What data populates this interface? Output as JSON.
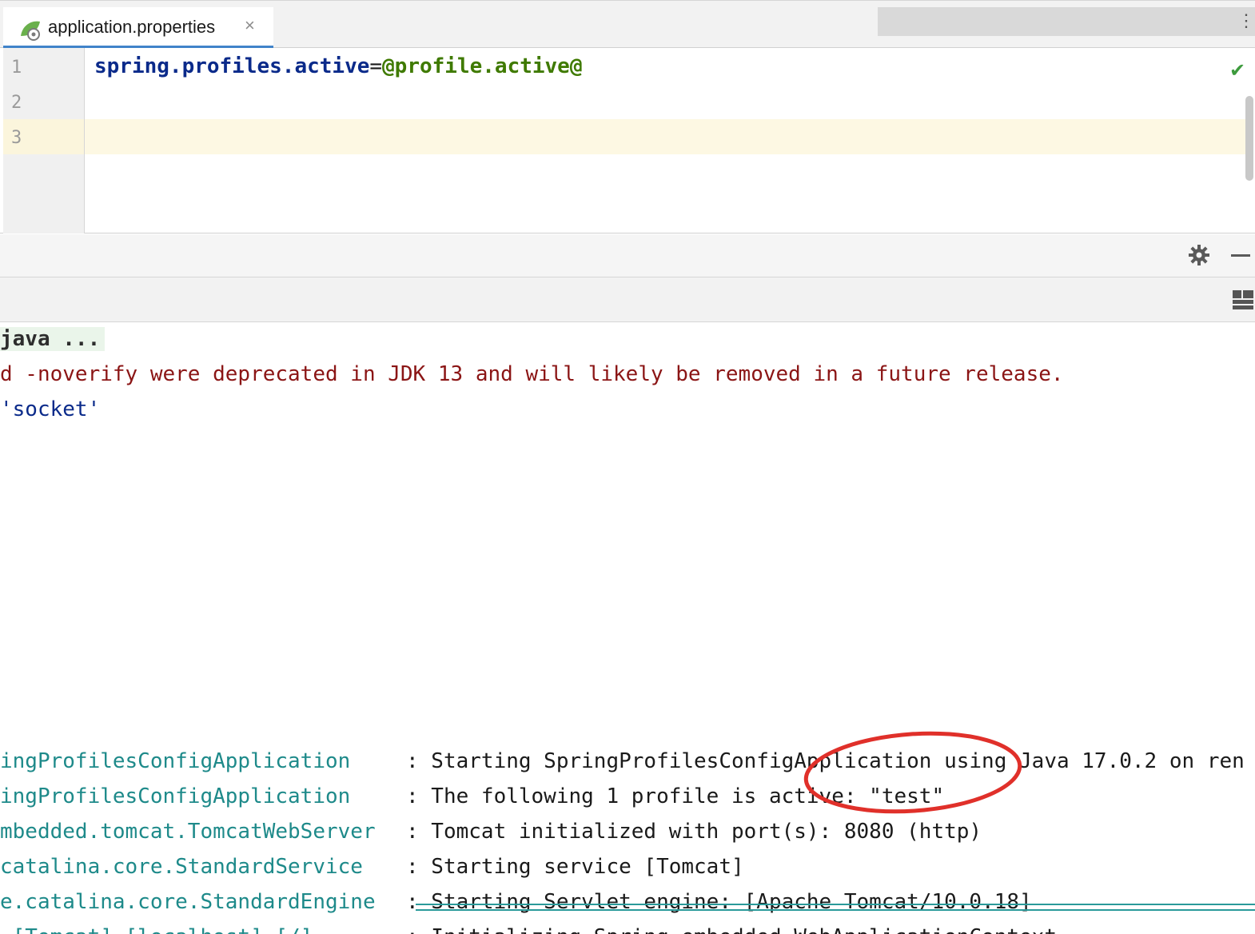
{
  "tab": {
    "label": "application.properties",
    "close": "×",
    "more": "⋮"
  },
  "editor": {
    "line_numbers": [
      "1",
      "2",
      "3"
    ],
    "code": {
      "key": "spring.profiles.active",
      "equals": "=",
      "value": "@profile.active@"
    },
    "status_icon": "check-icon"
  },
  "toolbar": {
    "settings_icon": "gear-icon",
    "minimize_icon": "minimize-icon",
    "layout_icon": "layout-icon"
  },
  "console": {
    "command_line": "java ...",
    "warning_line": "d -noverify were deprecated in JDK 13 and will likely be removed in a future release.",
    "socket_line": "'socket'",
    "log_rows": [
      {
        "logger": "ingProfilesConfigApplication",
        "message": ": Starting SpringProfilesConfigApplication using Java 17.0.2 on ren"
      },
      {
        "logger": "ingProfilesConfigApplication",
        "message": ": The following 1 profile is active: \"test\""
      },
      {
        "logger": "mbedded.tomcat.TomcatWebServer",
        "message": ": Tomcat initialized with port(s): 8080 (http)"
      },
      {
        "logger": "catalina.core.StandardService",
        "message": ": Starting service [Tomcat]"
      },
      {
        "logger": "e.catalina.core.StandardEngine",
        "message": ": Starting Servlet engine: [Apache Tomcat/10.0.18]"
      },
      {
        "logger": ".[Tomcat].[localhost].[/]",
        "message": ": Initializing Spring embedded WebApplicationContext"
      }
    ]
  },
  "annotation": {
    "color": "#e0302a"
  }
}
